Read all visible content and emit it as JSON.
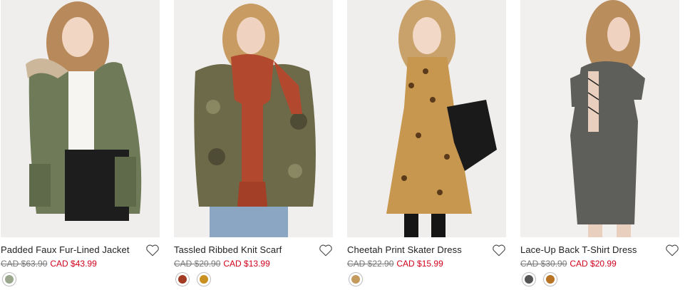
{
  "products": [
    {
      "title": "Padded Faux Fur-Lined Jacket",
      "old_price": "CAD $63.90",
      "new_price": "CAD $43.99",
      "swatches": [
        {
          "name": "olive",
          "color": "#9aa78d"
        }
      ]
    },
    {
      "title": "Tassled Ribbed Knit Scarf",
      "old_price": "CAD $20.90",
      "new_price": "CAD $13.99",
      "swatches": [
        {
          "name": "rust",
          "color": "#a13b24"
        },
        {
          "name": "mustard",
          "color": "#c9901f"
        }
      ]
    },
    {
      "title": "Cheetah Print Skater Dress",
      "old_price": "CAD $22.90",
      "new_price": "CAD $15.99",
      "swatches": [
        {
          "name": "cheetah",
          "color": "#c49a5e"
        }
      ]
    },
    {
      "title": "Lace-Up Back T-Shirt Dress",
      "old_price": "CAD $30.90",
      "new_price": "CAD $20.99",
      "swatches": [
        {
          "name": "charcoal",
          "color": "#555555"
        },
        {
          "name": "brown",
          "color": "#b87324"
        }
      ]
    }
  ],
  "colors": {
    "sale_price": "#d0021b",
    "old_price": "#777777"
  },
  "icons": {
    "wishlist": "heart-outline-icon"
  }
}
